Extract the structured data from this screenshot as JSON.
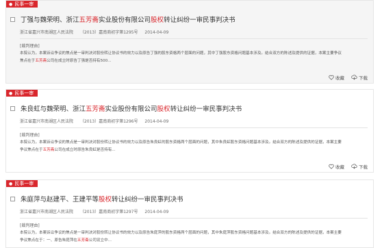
{
  "results": [
    {
      "tag": "民事一审",
      "title_parts": [
        {
          "t": "丁强与魏荣明、浙江",
          "h": false
        },
        {
          "t": "五芳斋",
          "h": true
        },
        {
          "t": "实业股份有限公司",
          "h": false
        },
        {
          "t": "股权",
          "h": true
        },
        {
          "t": "转让纠纷一审民事判决书",
          "h": false
        }
      ],
      "court": "浙江省嘉兴市南湖区人民法院",
      "case_no": "（2013）嘉南商初字第1295号",
      "date": "2014-04-09",
      "section_label": "[裁判理由]",
      "summary_parts": [
        {
          "t": "本院认为，本案诉讼争议的焦点是一审判决对股份转让协议书的效力以及原告丁强的股东资格两个层面的问题，其中丁强股东资格问题基本涉及。结合双方的陈述及提供的证据，本案主要争议焦点在于",
          "h": false
        },
        {
          "t": "五芳斋",
          "h": true
        },
        {
          "t": "公司在成立时原告丁强是否持有500...",
          "h": false
        }
      ],
      "collect_label": "收藏",
      "download_label": "下载"
    },
    {
      "tag": "民事一审",
      "title_parts": [
        {
          "t": "朱良虹与魏荣明、浙江",
          "h": false
        },
        {
          "t": "五芳斋",
          "h": true
        },
        {
          "t": "实业股份有限公司",
          "h": false
        },
        {
          "t": "股权",
          "h": true
        },
        {
          "t": "转让纠纷一审民事判决书",
          "h": false
        }
      ],
      "court": "浙江省嘉兴市南湖区人民法院",
      "case_no": "（2013）嘉南商初字第1296号",
      "date": "2014-04-09",
      "section_label": "[裁判理由]",
      "summary_parts": [
        {
          "t": "本院认为，本案诉讼争议的焦点是一审判决对股份转让协议书的效力以及原告朱良虹的股东资格两个层面的问题，其中朱良虹股东资格问题基本涉及。结合双方的陈述及提供的证据，本案主要争议焦点在于",
          "h": false
        },
        {
          "t": "五芳斋",
          "h": true
        },
        {
          "t": "公司在成立时原告朱良虹是否持有...",
          "h": false
        }
      ],
      "collect_label": "收藏",
      "download_label": "下载"
    },
    {
      "tag": "民事一审",
      "title_parts": [
        {
          "t": "朱庭萍与赵建平、王建平等",
          "h": false
        },
        {
          "t": "股权",
          "h": true
        },
        {
          "t": "转让纠纷一审民事判决书",
          "h": false
        }
      ],
      "court": "浙江省嘉兴市南湖区人民法院",
      "case_no": "（2013）嘉南商初字第1297号",
      "date": "2014-04-09",
      "section_label": "[裁判理由]",
      "summary_parts": [
        {
          "t": "本院认为，本案诉讼争议的焦点是一审判决对股份转让协议书的效力以及原告朱庭萍的股东资格两个层面的问题，其中朱庭萍股东资格问题基本涉及。结合双方的陈述及提供的证据，本案主要争议焦点在于：一、原告朱庭萍在",
          "h": false
        },
        {
          "t": "五芳斋",
          "h": true
        },
        {
          "t": "公司设立中...",
          "h": false
        }
      ],
      "collect_label": "收藏",
      "download_label": "下载"
    }
  ],
  "colors": {
    "accent": "#d9262c",
    "active_bg": "#f5f5f5"
  },
  "icons": {
    "collect": "heart-icon",
    "download": "download-icon"
  }
}
